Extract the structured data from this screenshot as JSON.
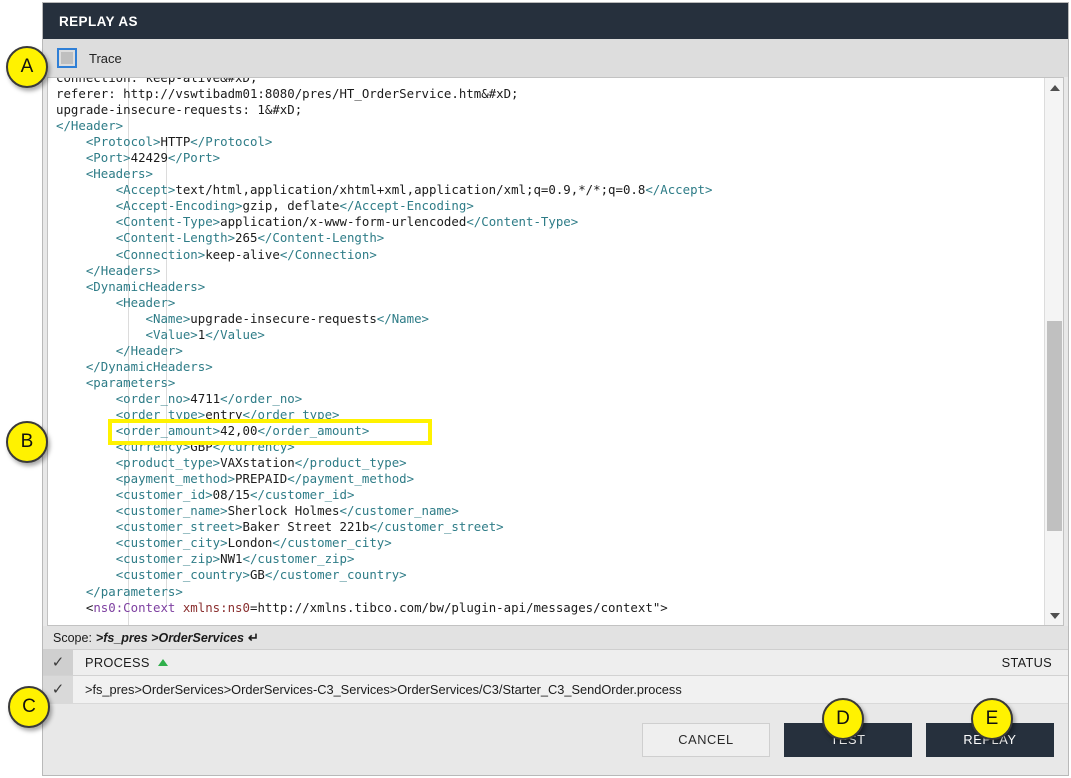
{
  "dialog": {
    "title": "REPLAY AS"
  },
  "trace": {
    "label": "Trace",
    "checked": false
  },
  "code": {
    "lines": [
      "connection: keep-alive&#xD;",
      "referer: http://vswtibadm01:8080/pres/HT_OrderService.htm&#xD;",
      "upgrade-insecure-requests: 1&#xD;",
      "</Header>",
      "    <Protocol>HTTP</Protocol>",
      "    <Port>42429</Port>",
      "    <Headers>",
      "        <Accept>text/html,application/xhtml+xml,application/xml;q=0.9,*/*;q=0.8</Accept>",
      "        <Accept-Encoding>gzip, deflate</Accept-Encoding>",
      "        <Content-Type>application/x-www-form-urlencoded</Content-Type>",
      "        <Content-Length>265</Content-Length>",
      "        <Connection>keep-alive</Connection>",
      "    </Headers>",
      "    <DynamicHeaders>",
      "        <Header>",
      "            <Name>upgrade-insecure-requests</Name>",
      "            <Value>1</Value>",
      "        </Header>",
      "    </DynamicHeaders>",
      "    <parameters>",
      "        <order_no>4711</order_no>",
      "        <order_type>entry</order_type>",
      "        <order_amount>42,00</order_amount>",
      "        <currency>GBP</currency>",
      "        <product_type>VAXstation</product_type>",
      "        <payment_method>PREPAID</payment_method>",
      "        <customer_id>08/15</customer_id>",
      "        <customer_name>Sherlock Holmes</customer_name>",
      "        <customer_street>Baker Street 221b</customer_street>",
      "        <customer_city>London</customer_city>",
      "        <customer_zip>NW1</customer_zip>",
      "        <customer_country>GB</customer_country>",
      "    </parameters>",
      "    <ns0:Context xmlns:ns0=\"http://xmlns.tibco.com/bw/plugin-api/messages/context\">"
    ],
    "highlighted_line": "<order_amount>42,00</order_amount>",
    "highlight_color": "#fff200"
  },
  "scope": {
    "label": "Scope:",
    "path": ">fs_pres >OrderServices",
    "return_glyph": "↵"
  },
  "table": {
    "columns": [
      "PROCESS",
      "STATUS"
    ],
    "sort_column": "PROCESS",
    "sort_direction": "asc",
    "header_checkmark": "✓",
    "rows": [
      {
        "checked": true,
        "checkmark": "✓",
        "process": ">fs_pres>OrderServices>OrderServices-C3_Services>OrderServices/C3/Starter_C3_SendOrder.process",
        "status": ""
      }
    ]
  },
  "footer": {
    "cancel_label": "CANCEL",
    "test_label": "TEST",
    "replay_label": "REPLAY"
  },
  "annotations": [
    {
      "id": "A",
      "label": "A"
    },
    {
      "id": "B",
      "label": "B"
    },
    {
      "id": "C",
      "label": "C"
    },
    {
      "id": "D",
      "label": "D"
    },
    {
      "id": "E",
      "label": "E"
    }
  ],
  "colors": {
    "header_bg": "#26303d",
    "accent_button": "#26303d",
    "annotation": "#fff200",
    "tag": "#2e7c87",
    "sort_arrow": "#2faf4b"
  }
}
